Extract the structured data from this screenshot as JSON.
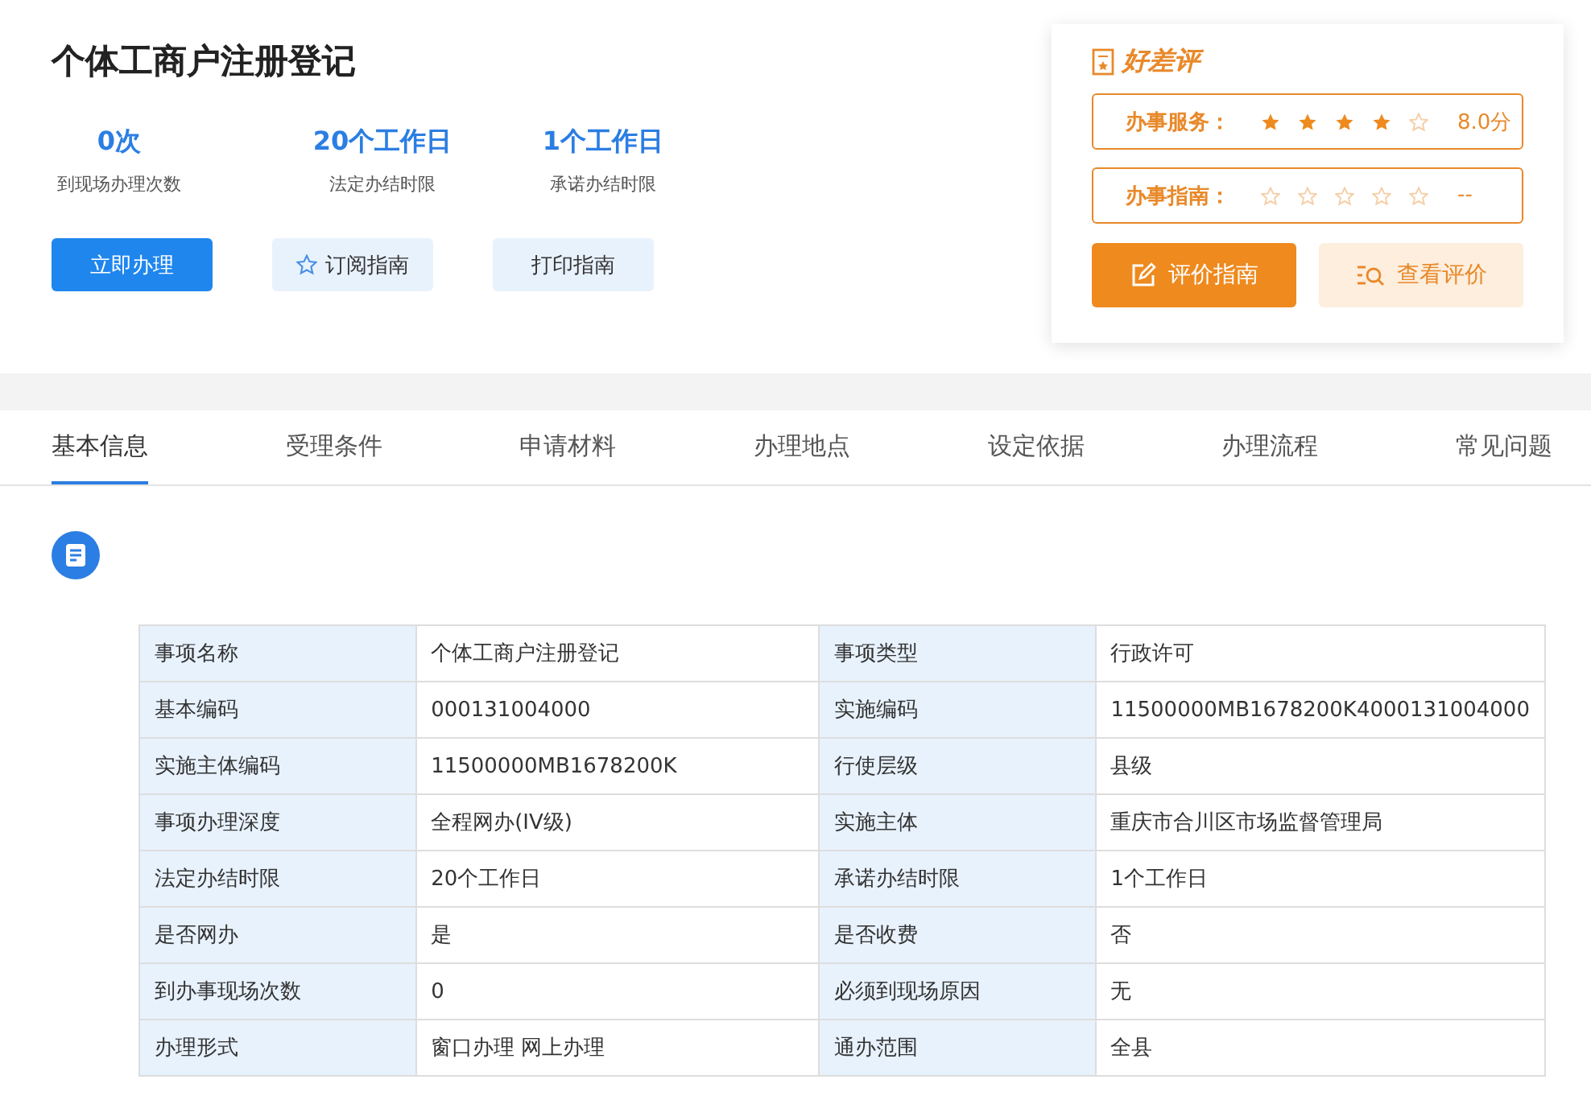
{
  "header": {
    "title": "个体工商户注册登记",
    "stats": [
      {
        "value": "0次",
        "label": "到现场办理次数"
      },
      {
        "value": "20个工作日",
        "label": "法定办结时限"
      },
      {
        "value": "1个工作日",
        "label": "承诺办结时限"
      }
    ],
    "buttons": [
      {
        "label": "立即办理",
        "kind": "primary"
      },
      {
        "label": "订阅指南",
        "kind": "star"
      },
      {
        "label": "打印指南",
        "kind": "plain"
      }
    ]
  },
  "rating": {
    "title": "好差评",
    "rows": [
      {
        "label": "办事服务：",
        "stars": 4,
        "score": "8.0分"
      },
      {
        "label": "办事指南：",
        "stars": 0,
        "score": "--"
      }
    ],
    "buttons": [
      {
        "label": "评价指南",
        "kind": "primary"
      },
      {
        "label": "查看评价",
        "kind": "secondary"
      }
    ]
  },
  "tabs": [
    {
      "label": "基本信息",
      "selected": true
    },
    {
      "label": "受理条件",
      "selected": false
    },
    {
      "label": "申请材料",
      "selected": false
    },
    {
      "label": "办理地点",
      "selected": false
    },
    {
      "label": "设定依据",
      "selected": false
    },
    {
      "label": "办理流程",
      "selected": false
    },
    {
      "label": "常见问题",
      "selected": false
    }
  ],
  "table": {
    "rows": [
      [
        "事项名称",
        "个体工商户注册登记",
        "事项类型",
        "行政许可"
      ],
      [
        "基本编码",
        "000131004000",
        "实施编码",
        "11500000MB1678200K4000131004000"
      ],
      [
        "实施主体编码",
        "11500000MB1678200K",
        "行使层级",
        "县级"
      ],
      [
        "事项办理深度",
        "全程网办(IV级)",
        "实施主体",
        "重庆市合川区市场监督管理局"
      ],
      [
        "法定办结时限",
        "20个工作日",
        "承诺办结时限",
        "1个工作日"
      ],
      [
        "是否网办",
        "是",
        "是否收费",
        "否"
      ],
      [
        "到办事现场次数",
        "0",
        "必须到现场原因",
        "无"
      ],
      [
        "办理形式",
        "窗口办理 网上办理",
        "通办范围",
        "全县"
      ]
    ]
  }
}
